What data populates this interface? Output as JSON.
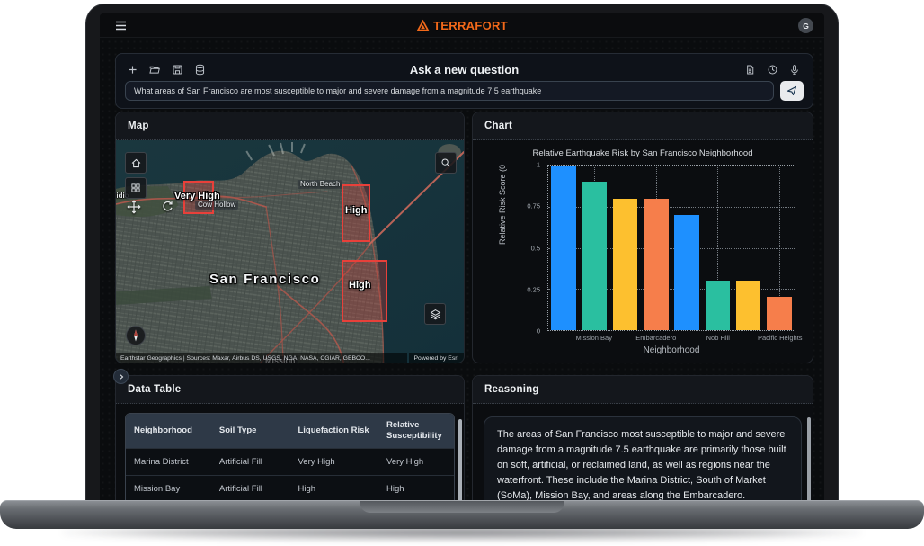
{
  "navbar": {
    "logo_text": "TERRAFORT",
    "avatar_initial": "G"
  },
  "ask": {
    "title": "Ask a new question",
    "question": "What areas of San Francisco are most susceptible to major and severe damage from a magnitude 7.5 earthquake",
    "toolbar_icons_left": [
      "new",
      "open",
      "save",
      "data"
    ],
    "toolbar_icons_right": [
      "script",
      "history",
      "microphone"
    ]
  },
  "map_panel": {
    "title": "Map",
    "labels": {
      "city": "San Francisco",
      "north_beach": "North Beach",
      "cow_hollow": "Cow Hollow",
      "presidio": "Presidio",
      "mission": "Mission"
    },
    "zones": [
      {
        "label": "Very High"
      },
      {
        "label": "High"
      },
      {
        "label": "High"
      }
    ],
    "attribution": "Earthstar Geographics | Sources: Maxar, Airbus DS, USGS, NGA, NASA, CGIAR, GEBCO...",
    "powered_by": "Powered by Esri"
  },
  "chart_panel": {
    "title": "Chart"
  },
  "chart_data": {
    "type": "bar",
    "title": "Relative Earthquake Risk by San Francisco Neighborhood",
    "xlabel": "Neighborhood",
    "ylabel": "Relative Risk Score (0",
    "ylim": [
      0,
      1
    ],
    "yticks": [
      0,
      0.25,
      0.5,
      0.75,
      1
    ],
    "categories": [
      "",
      "Mission Bay",
      "",
      "Embarcadero",
      "",
      "Nob Hill",
      "",
      "Pacific Heights"
    ],
    "values": [
      1.0,
      0.9,
      0.8,
      0.8,
      0.7,
      0.3,
      0.3,
      0.2
    ],
    "bar_colors": [
      "#1e90ff",
      "#2abfa0",
      "#fdc02f",
      "#f67e4b"
    ],
    "grid": "dotted",
    "legend": "none"
  },
  "table_panel": {
    "title": "Data Table",
    "columns": [
      "Neighborhood",
      "Soil Type",
      "Liquefaction Risk",
      "Relative Susceptibility"
    ],
    "rows": [
      [
        "Marina District",
        "Artificial Fill",
        "Very High",
        "Very High"
      ],
      [
        "Mission Bay",
        "Artificial Fill",
        "High",
        "High"
      ]
    ]
  },
  "reasoning_panel": {
    "title": "Reasoning",
    "text": "The areas of San Francisco most susceptible to major and severe damage from a magnitude 7.5 earthquake are primarily those built on soft, artificial, or reclaimed land, as well as regions near the waterfront. These include the Marina District, South of Market (SoMa), Mission Bay, and areas along the Embarcadero."
  },
  "colors": {
    "accent_orange": "#f2691a",
    "zone_red": "#e8403a",
    "panel_bg": "#0b0d10",
    "header_bg": "#14171c"
  }
}
